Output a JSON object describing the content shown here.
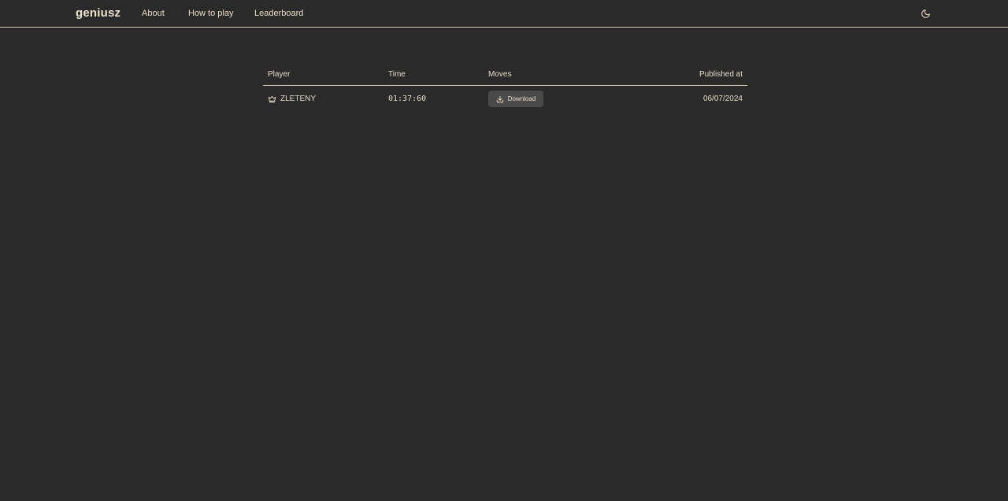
{
  "header": {
    "brand": "geniusz",
    "nav": [
      {
        "label": "About"
      },
      {
        "label": "How to play"
      },
      {
        "label": "Leaderboard"
      }
    ],
    "theme_toggle_icon": "moon-icon"
  },
  "leaderboard": {
    "columns": {
      "player": "Player",
      "time": "Time",
      "moves": "Moves",
      "published": "Published at"
    },
    "rows": [
      {
        "rank_icon": "crown-icon",
        "player": "ZLETENY",
        "time": "01:37:60",
        "moves_button": "Download",
        "published_at": "06/07/2024"
      }
    ]
  },
  "colors": {
    "background": "#2a2a2a",
    "text": "#e6dcc6",
    "button_bg": "#4a4a4a"
  }
}
